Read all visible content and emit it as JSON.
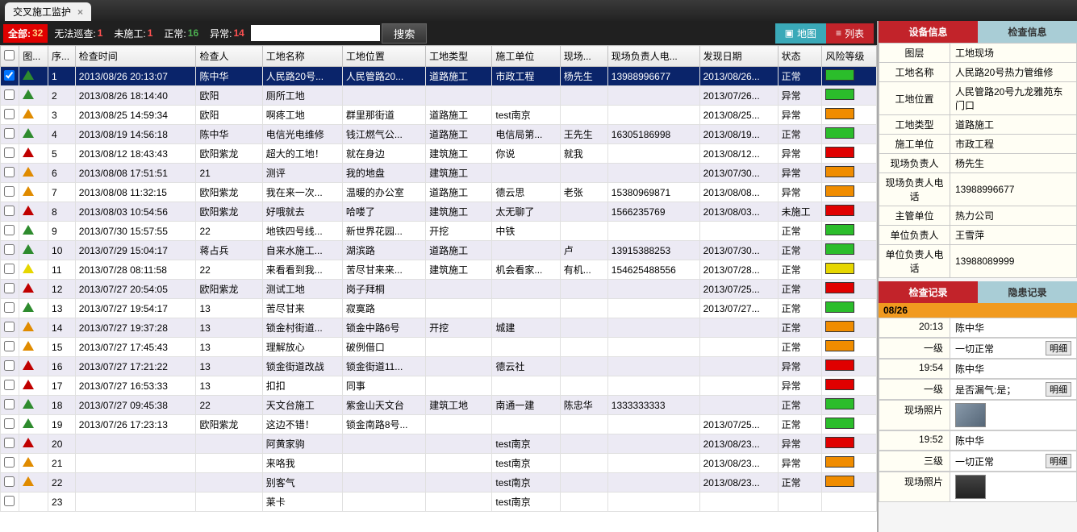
{
  "tab_title": "交叉施工监护",
  "toolbar": {
    "all_label": "全部:",
    "all_count": "32",
    "nopatrol_label": "无法巡查:",
    "nopatrol_count": "1",
    "nowork_label": "未施工:",
    "nowork_count": "1",
    "normal_label": "正常:",
    "normal_count": "16",
    "abnormal_label": "异常:",
    "abnormal_count": "14",
    "search_btn": "搜索",
    "map_btn": "地图",
    "list_btn": "列表"
  },
  "columns": {
    "c0": "",
    "c1": "图...",
    "c2": "序...",
    "c3": "检查时间",
    "c4": "检查人",
    "c5": "工地名称",
    "c6": "工地位置",
    "c7": "工地类型",
    "c8": "施工单位",
    "c9": "现场...",
    "c10": "现场负责人电...",
    "c11": "发现日期",
    "c12": "状态",
    "c13": "风险等级"
  },
  "rows": [
    {
      "sel": true,
      "tri": "green",
      "seq": "1",
      "time": "2013/08/26 20:13:07",
      "insp": "陈中华",
      "site": "人民路20号...",
      "loc": "人民管路20...",
      "type": "道路施工",
      "unit": "市政工程",
      "mgr": "杨先生",
      "tel": "13988996677",
      "found": "2013/08/26...",
      "status": "正常",
      "risk": "#2bbd2b"
    },
    {
      "tri": "green",
      "seq": "2",
      "time": "2013/08/26 18:14:40",
      "insp": "欧阳",
      "site": "厕所工地",
      "loc": "",
      "type": "",
      "unit": "",
      "mgr": "",
      "tel": "",
      "found": "2013/07/26...",
      "status": "异常",
      "risk": "#2bbd2b"
    },
    {
      "tri": "orange",
      "seq": "3",
      "time": "2013/08/25 14:59:34",
      "insp": "欧阳",
      "site": "啊疼工地",
      "loc": "群里那街道",
      "type": "道路施工",
      "unit": "test南京",
      "mgr": "",
      "tel": "",
      "found": "2013/08/25...",
      "status": "异常",
      "risk": "#f08c00"
    },
    {
      "tri": "green",
      "seq": "4",
      "time": "2013/08/19 14:56:18",
      "insp": "陈中华",
      "site": "电信光电维修",
      "loc": "钱江燃气公...",
      "type": "道路施工",
      "unit": "电信局第...",
      "mgr": "王先生",
      "tel": "16305186998",
      "found": "2013/08/19...",
      "status": "正常",
      "risk": "#2bbd2b"
    },
    {
      "tri": "red",
      "seq": "5",
      "time": "2013/08/12 18:43:43",
      "insp": "欧阳紫龙",
      "site": "超大的工地！",
      "loc": "就在身边",
      "type": "建筑施工",
      "unit": "你说",
      "mgr": "就我",
      "tel": "",
      "found": "2013/08/12...",
      "status": "异常",
      "risk": "#e00000"
    },
    {
      "tri": "orange",
      "seq": "6",
      "time": "2013/08/08 17:51:51",
      "insp": "21",
      "site": "测评",
      "loc": "我的地盘",
      "type": "建筑施工",
      "unit": "",
      "mgr": "",
      "tel": "",
      "found": "2013/07/30...",
      "status": "异常",
      "risk": "#f08c00"
    },
    {
      "tri": "orange",
      "seq": "7",
      "time": "2013/08/08 11:32:15",
      "insp": "欧阳紫龙",
      "site": "我在来一次...",
      "loc": "温暖的办公室",
      "type": "道路施工",
      "unit": "德云思",
      "mgr": "老张",
      "tel": "15380969871",
      "found": "2013/08/08...",
      "status": "异常",
      "risk": "#f08c00"
    },
    {
      "tri": "red",
      "seq": "8",
      "time": "2013/08/03 10:54:56",
      "insp": "欧阳紫龙",
      "site": "好哦就去",
      "loc": "哈喽了",
      "type": "建筑施工",
      "unit": "太无聊了",
      "mgr": "",
      "tel": "1566235769",
      "found": "2013/08/03...",
      "status": "未施工",
      "risk": "#e00000"
    },
    {
      "tri": "green",
      "seq": "9",
      "time": "2013/07/30 15:57:55",
      "insp": "22",
      "site": "地铁四号线...",
      "loc": "新世界花园...",
      "type": "开挖",
      "unit": "中铁",
      "mgr": "",
      "tel": "",
      "found": "",
      "status": "正常",
      "risk": "#2bbd2b"
    },
    {
      "tri": "green",
      "seq": "10",
      "time": "2013/07/29 15:04:17",
      "insp": "蒋占兵",
      "site": "自来水施工...",
      "loc": "湖滨路",
      "type": "道路施工",
      "unit": "",
      "mgr": "卢",
      "tel": "13915388253",
      "found": "2013/07/30...",
      "status": "正常",
      "risk": "#2bbd2b"
    },
    {
      "tri": "yellow",
      "seq": "11",
      "time": "2013/07/28 08:11:58",
      "insp": "22",
      "site": "来看看到我...",
      "loc": "苦尽甘来来...",
      "type": "建筑施工",
      "unit": "机会看家...",
      "mgr": "有机...",
      "tel": "154625488556",
      "found": "2013/07/28...",
      "status": "正常",
      "risk": "#e6d600"
    },
    {
      "tri": "red",
      "seq": "12",
      "time": "2013/07/27 20:54:05",
      "insp": "欧阳紫龙",
      "site": "测试工地",
      "loc": "岗子拜桐",
      "type": "",
      "unit": "",
      "mgr": "",
      "tel": "",
      "found": "2013/07/25...",
      "status": "正常",
      "risk": "#e00000"
    },
    {
      "tri": "green",
      "seq": "13",
      "time": "2013/07/27 19:54:17",
      "insp": "13",
      "site": "苦尽甘来",
      "loc": "寂寞路",
      "type": "",
      "unit": "",
      "mgr": "",
      "tel": "",
      "found": "2013/07/27...",
      "status": "正常",
      "risk": "#2bbd2b"
    },
    {
      "tri": "orange",
      "seq": "14",
      "time": "2013/07/27 19:37:28",
      "insp": "13",
      "site": "锁金村街道...",
      "loc": "锁金中路6号",
      "type": "开挖",
      "unit": "城建",
      "mgr": "",
      "tel": "",
      "found": "",
      "status": "正常",
      "risk": "#f08c00"
    },
    {
      "tri": "orange",
      "seq": "15",
      "time": "2013/07/27 17:45:43",
      "insp": "13",
      "site": "理解放心",
      "loc": "破例借口",
      "type": "",
      "unit": "",
      "mgr": "",
      "tel": "",
      "found": "",
      "status": "正常",
      "risk": "#f08c00"
    },
    {
      "tri": "red",
      "seq": "16",
      "time": "2013/07/27 17:21:22",
      "insp": "13",
      "site": "锁金街道改战",
      "loc": "锁金街道11...",
      "type": "",
      "unit": "德云社",
      "mgr": "",
      "tel": "",
      "found": "",
      "status": "异常",
      "risk": "#e00000"
    },
    {
      "tri": "red",
      "seq": "17",
      "time": "2013/07/27 16:53:33",
      "insp": "13",
      "site": "扣扣",
      "loc": "同事",
      "type": "",
      "unit": "",
      "mgr": "",
      "tel": "",
      "found": "",
      "status": "异常",
      "risk": "#e00000"
    },
    {
      "tri": "green",
      "seq": "18",
      "time": "2013/07/27 09:45:38",
      "insp": "22",
      "site": "天文台施工",
      "loc": "紫金山天文台",
      "type": "建筑工地",
      "unit": "南通一建",
      "mgr": "陈忠华",
      "tel": "1333333333",
      "found": "",
      "status": "正常",
      "risk": "#2bbd2b"
    },
    {
      "tri": "green",
      "seq": "19",
      "time": "2013/07/26 17:23:13",
      "insp": "欧阳紫龙",
      "site": "这边不错！",
      "loc": "锁金南路8号...",
      "type": "",
      "unit": "",
      "mgr": "",
      "tel": "",
      "found": "2013/07/25...",
      "status": "正常",
      "risk": "#2bbd2b"
    },
    {
      "tri": "red",
      "seq": "20",
      "time": "",
      "insp": "",
      "site": "阿黄家驹",
      "loc": "",
      "type": "",
      "unit": "test南京",
      "mgr": "",
      "tel": "",
      "found": "2013/08/23...",
      "status": "异常",
      "risk": "#e00000"
    },
    {
      "tri": "orange",
      "seq": "21",
      "time": "",
      "insp": "",
      "site": "来咯我",
      "loc": "",
      "type": "",
      "unit": "test南京",
      "mgr": "",
      "tel": "",
      "found": "2013/08/23...",
      "status": "异常",
      "risk": "#f08c00"
    },
    {
      "tri": "orange",
      "seq": "22",
      "time": "",
      "insp": "",
      "site": "别客气",
      "loc": "",
      "type": "",
      "unit": "test南京",
      "mgr": "",
      "tel": "",
      "found": "2013/08/23...",
      "status": "正常",
      "risk": "#f08c00"
    },
    {
      "tri": "",
      "seq": "23",
      "time": "",
      "insp": "",
      "site": "莱卡",
      "loc": "",
      "type": "",
      "unit": "test南京",
      "mgr": "",
      "tel": "",
      "found": "",
      "status": "",
      "risk": ""
    }
  ],
  "right_tabs": {
    "device": "设备信息",
    "check": "检查信息"
  },
  "device_info": [
    {
      "k": "图层",
      "v": "工地现场"
    },
    {
      "k": "工地名称",
      "v": "人民路20号热力管维修"
    },
    {
      "k": "工地位置",
      "v": "人民管路20号九龙雅苑东门口"
    },
    {
      "k": "工地类型",
      "v": "道路施工"
    },
    {
      "k": "施工单位",
      "v": "市政工程"
    },
    {
      "k": "现场负责人",
      "v": "杨先生"
    },
    {
      "k": "现场负责人电话",
      "v": "13988996677"
    },
    {
      "k": "主管单位",
      "v": "热力公司"
    },
    {
      "k": "单位负责人",
      "v": "王雪萍"
    },
    {
      "k": "单位负责人电话",
      "v": "13988089999"
    }
  ],
  "lower_tabs": {
    "check_rec": "检查记录",
    "danger_rec": "隐患记录"
  },
  "date_header": "08/26",
  "records": [
    {
      "t": "20:13",
      "who": "陈中华",
      "level": "一级",
      "text": "一切正常",
      "detail": "明细"
    },
    {
      "t": "19:54",
      "who": "陈中华",
      "level": "一级",
      "text": "是否漏气:是；",
      "detail": "明细",
      "photo": "1"
    },
    {
      "t": "19:52",
      "who": "陈中华",
      "level": "三级",
      "text": "一切正常",
      "detail": "明细",
      "photo": "2"
    }
  ],
  "photo_label": "现场照片"
}
